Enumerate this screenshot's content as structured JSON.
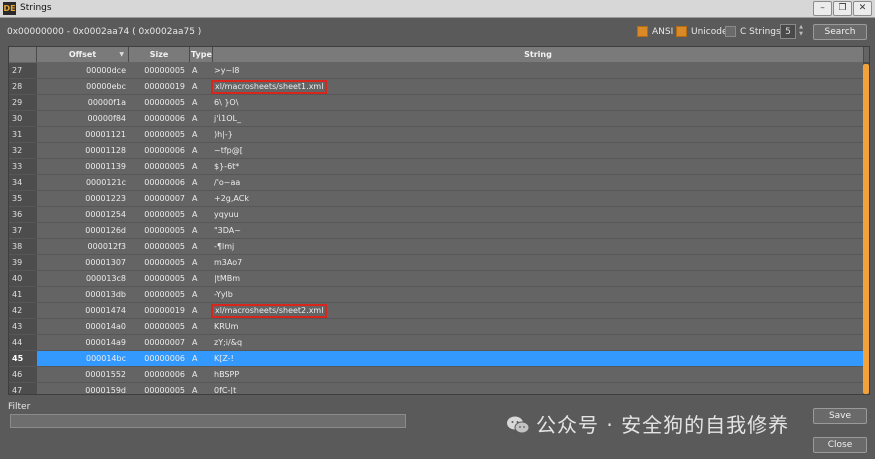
{
  "window": {
    "title": "Strings",
    "app_icon": "DE",
    "minimize_glyph": "–",
    "restore_glyph": "❐",
    "close_glyph": "✕"
  },
  "toolbar": {
    "range": "0x00000000 - 0x0002aa74 ( 0x0002aa75 )",
    "ansi_label": "ANSI",
    "unicode_label": "Unicode",
    "cstrings_label": "C Strings",
    "min_length": "5",
    "search_label": "Search",
    "ansi_checked": true,
    "unicode_checked": true,
    "cstrings_checked": false,
    "accent_color": "#d98a27"
  },
  "table": {
    "headers": {
      "offset": "Offset",
      "size": "Size",
      "type": "Type",
      "string": "String"
    },
    "rows": [
      {
        "num": "27",
        "offset": "00000dce",
        "size": "00000005",
        "type": "A",
        "string": ">y~l8",
        "highlight": false,
        "selected": false
      },
      {
        "num": "28",
        "offset": "00000ebc",
        "size": "00000019",
        "type": "A",
        "string": "xl/macrosheets/sheet1.xml",
        "highlight": true,
        "selected": false
      },
      {
        "num": "29",
        "offset": "00000f1a",
        "size": "00000005",
        "type": "A",
        "string": "6\\ }O\\",
        "highlight": false,
        "selected": false
      },
      {
        "num": "30",
        "offset": "00000f84",
        "size": "00000006",
        "type": "A",
        "string": "j'ἰ1OL_",
        "highlight": false,
        "selected": false
      },
      {
        "num": "31",
        "offset": "00001121",
        "size": "00000005",
        "type": "A",
        "string": ")h|-}",
        "highlight": false,
        "selected": false
      },
      {
        "num": "32",
        "offset": "00001128",
        "size": "00000006",
        "type": "A",
        "string": "~tfp@[",
        "highlight": false,
        "selected": false
      },
      {
        "num": "33",
        "offset": "00001139",
        "size": "00000005",
        "type": "A",
        "string": "$}-6t*",
        "highlight": false,
        "selected": false
      },
      {
        "num": "34",
        "offset": "0000121c",
        "size": "00000006",
        "type": "A",
        "string": "/'o~aa",
        "highlight": false,
        "selected": false
      },
      {
        "num": "35",
        "offset": "00001223",
        "size": "00000007",
        "type": "A",
        "string": "+2g,ACk",
        "highlight": false,
        "selected": false
      },
      {
        "num": "36",
        "offset": "00001254",
        "size": "00000005",
        "type": "A",
        "string": "yqyuu",
        "highlight": false,
        "selected": false
      },
      {
        "num": "37",
        "offset": "0000126d",
        "size": "00000005",
        "type": "A",
        "string": "\"3DA~",
        "highlight": false,
        "selected": false
      },
      {
        "num": "38",
        "offset": "000012f3",
        "size": "00000005",
        "type": "A",
        "string": "-¶lmj",
        "highlight": false,
        "selected": false
      },
      {
        "num": "39",
        "offset": "00001307",
        "size": "00000005",
        "type": "A",
        "string": "m3Ao7",
        "highlight": false,
        "selected": false
      },
      {
        "num": "40",
        "offset": "000013c8",
        "size": "00000005",
        "type": "A",
        "string": "|tMBm",
        "highlight": false,
        "selected": false
      },
      {
        "num": "41",
        "offset": "000013db",
        "size": "00000005",
        "type": "A",
        "string": "-Yylb",
        "highlight": false,
        "selected": false
      },
      {
        "num": "42",
        "offset": "00001474",
        "size": "00000019",
        "type": "A",
        "string": "xl/macrosheets/sheet2.xml",
        "highlight": true,
        "selected": false
      },
      {
        "num": "43",
        "offset": "000014a0",
        "size": "00000005",
        "type": "A",
        "string": " KRUm",
        "highlight": false,
        "selected": false
      },
      {
        "num": "44",
        "offset": "000014a9",
        "size": "00000007",
        "type": "A",
        "string": "zY;i/&q",
        "highlight": false,
        "selected": false
      },
      {
        "num": "45",
        "offset": "000014bc",
        "size": "00000006",
        "type": "A",
        "string": "K[Z-!",
        "highlight": false,
        "selected": true
      },
      {
        "num": "46",
        "offset": "00001552",
        "size": "00000006",
        "type": "A",
        "string": " hBSPP",
        "highlight": false,
        "selected": false
      },
      {
        "num": "47",
        "offset": "0000159d",
        "size": "00000005",
        "type": "A",
        "string": "0fC-|t",
        "highlight": false,
        "selected": false
      }
    ],
    "selection_color": "#3399ff",
    "highlight_color": "#d7261e"
  },
  "footer": {
    "filter_label": "Filter",
    "filter_value": "",
    "save_label": "Save",
    "close_label": "Close"
  },
  "watermark": {
    "text": "公众号 · 安全狗的自我修养"
  }
}
